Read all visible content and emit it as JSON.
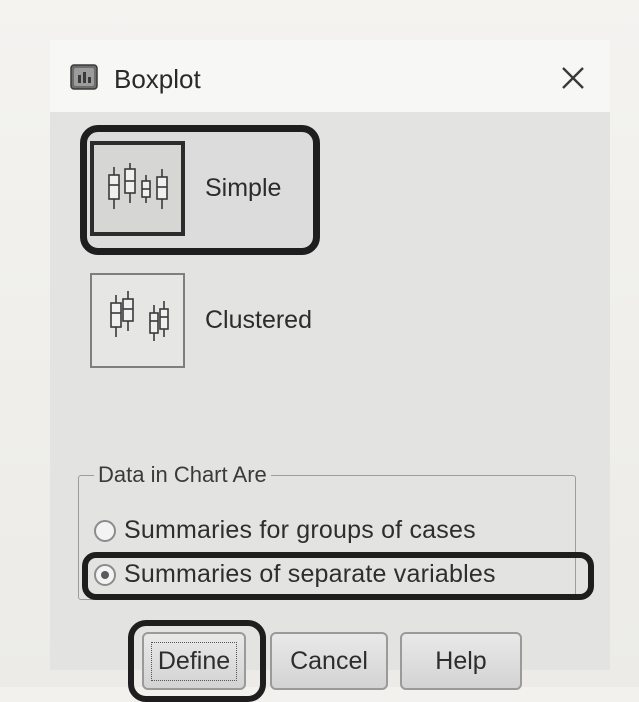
{
  "window": {
    "title": "Boxplot",
    "close_icon": "close-icon"
  },
  "chart_types": [
    {
      "label": "Simple",
      "icon": "simple-boxplot-icon",
      "selected": true
    },
    {
      "label": "Clustered",
      "icon": "clustered-boxplot-icon",
      "selected": false
    }
  ],
  "data_group": {
    "title": "Data in Chart Are",
    "options": [
      {
        "label": "Summaries for groups of cases",
        "selected": false
      },
      {
        "label": "Summaries of separate variables",
        "selected": true
      }
    ]
  },
  "buttons": {
    "define": "Define",
    "cancel": "Cancel",
    "help": "Help"
  },
  "colors": {
    "highlight_border": "#1e1e1e",
    "dialog_bg": "#e3e3e2"
  }
}
